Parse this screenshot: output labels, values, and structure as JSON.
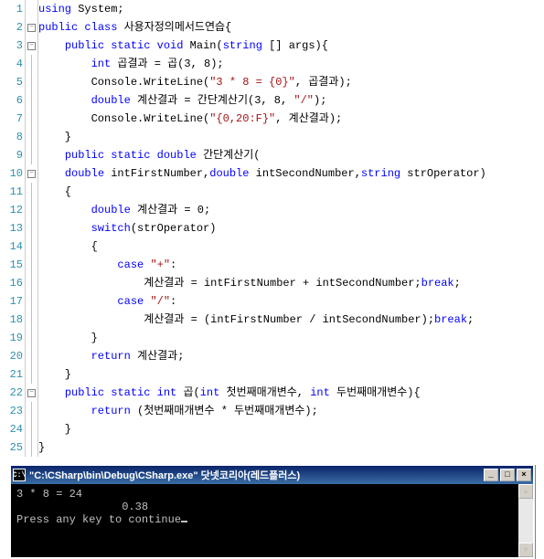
{
  "lines": [
    {
      "n": 1,
      "fold": "",
      "html": "<span class='kw'>using</span> System;"
    },
    {
      "n": 2,
      "fold": "minus",
      "html": "<span class='kw'>public</span> <span class='kw'>class</span> 사용자정의메서드연습{"
    },
    {
      "n": 3,
      "fold": "minus",
      "html": "    <span class='kw'>public</span> <span class='kw'>static</span> <span class='kw'>void</span> Main(<span class='kw'>string</span> [] args){"
    },
    {
      "n": 4,
      "fold": "line",
      "html": "        <span class='kw'>int</span> 곱결과 = 곱(3, 8);"
    },
    {
      "n": 5,
      "fold": "line",
      "html": "        Console.WriteLine(<span class='str'>\"3 * 8 = {0}\"</span>, 곱결과);"
    },
    {
      "n": 6,
      "fold": "line",
      "html": "        <span class='kw'>double</span> 계산결과 = 간단계산기(3, 8, <span class='str'>\"/\"</span>);"
    },
    {
      "n": 7,
      "fold": "line",
      "html": "        Console.WriteLine(<span class='str'>\"{0,20:F}\"</span>, 계산결과);"
    },
    {
      "n": 8,
      "fold": "line",
      "html": "    }"
    },
    {
      "n": 9,
      "fold": "line",
      "html": "    <span class='kw'>public</span> <span class='kw'>static</span> <span class='kw'>double</span> 간단계산기("
    },
    {
      "n": 10,
      "fold": "minus",
      "html": "    <span class='kw'>double</span> intFirstNumber,<span class='kw'>double</span> intSecondNumber,<span class='kw'>string</span> strOperator)"
    },
    {
      "n": 11,
      "fold": "line",
      "html": "    {"
    },
    {
      "n": 12,
      "fold": "line",
      "html": "        <span class='kw'>double</span> 계산결과 = 0;"
    },
    {
      "n": 13,
      "fold": "line",
      "html": "        <span class='kw'>switch</span>(strOperator)"
    },
    {
      "n": 14,
      "fold": "line",
      "html": "        {"
    },
    {
      "n": 15,
      "fold": "line",
      "html": "            <span class='kw'>case</span> <span class='str'>\"+\"</span>:"
    },
    {
      "n": 16,
      "fold": "line",
      "html": "                계산결과 = intFirstNumber + intSecondNumber;<span class='kw'>break</span>;"
    },
    {
      "n": 17,
      "fold": "line",
      "html": "            <span class='kw'>case</span> <span class='str'>\"/\"</span>:"
    },
    {
      "n": 18,
      "fold": "line",
      "html": "                계산결과 = (intFirstNumber / intSecondNumber);<span class='kw'>break</span>;"
    },
    {
      "n": 19,
      "fold": "line",
      "html": "        }"
    },
    {
      "n": 20,
      "fold": "line",
      "html": "        <span class='kw'>return</span> 계산결과;"
    },
    {
      "n": 21,
      "fold": "line",
      "html": "    }"
    },
    {
      "n": 22,
      "fold": "minus",
      "html": "    <span class='kw'>public</span> <span class='kw'>static</span> <span class='kw'>int</span> 곱(<span class='kw'>int</span> 첫번째매개변수, <span class='kw'>int</span> 두번째매개변수){"
    },
    {
      "n": 23,
      "fold": "line",
      "html": "        <span class='kw'>return</span> (첫번째매개변수 * 두번째매개변수);"
    },
    {
      "n": 24,
      "fold": "line",
      "html": "    }"
    },
    {
      "n": 25,
      "fold": "line",
      "html": "}"
    }
  ],
  "console": {
    "icon_text": "C:\\",
    "title": "\"C:\\CSharp\\bin\\Debug\\CSharp.exe\" 닷넷코리아(레드플러스)",
    "out1": "3 * 8 = 24",
    "out2": "                0.38",
    "out3": "Press any key to continue"
  },
  "btn": {
    "min": "_",
    "max": "□",
    "close": "×",
    "up": "▲",
    "down": "▼"
  }
}
